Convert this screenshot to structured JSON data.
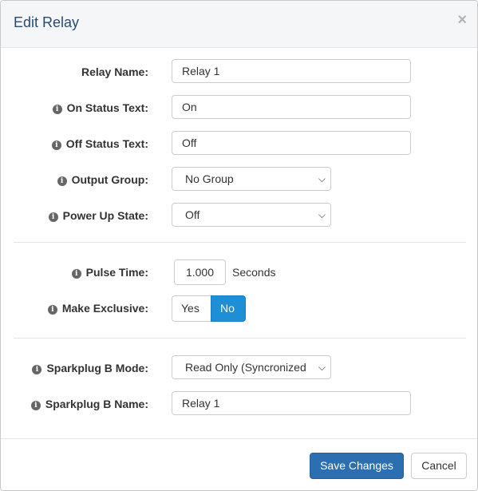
{
  "header": {
    "title": "Edit Relay",
    "close_glyph": "×"
  },
  "icon_glyph": "i",
  "form": {
    "relay_name": {
      "label": "Relay Name:",
      "value": "Relay 1"
    },
    "on_status": {
      "label": "On Status Text:",
      "value": "On"
    },
    "off_status": {
      "label": "Off Status Text:",
      "value": "Off"
    },
    "output_group": {
      "label": "Output Group:",
      "value": "No Group"
    },
    "power_up_state": {
      "label": "Power Up State:",
      "value": "Off"
    },
    "pulse_time": {
      "label": "Pulse Time:",
      "value": "1.000",
      "unit": "Seconds"
    },
    "make_exclusive": {
      "label": "Make Exclusive:",
      "yes": "Yes",
      "no": "No",
      "selected": "No"
    },
    "sparkplug_mode": {
      "label": "Sparkplug B Mode:",
      "value": "Read Only (Syncronized"
    },
    "sparkplug_name": {
      "label": "Sparkplug B Name:",
      "value": "Relay 1"
    }
  },
  "footer": {
    "save_label": "Save Changes",
    "cancel_label": "Cancel"
  },
  "colors": {
    "primary": "#2b6fb0",
    "toggle_active": "#1e8fd6",
    "title": "#2a4a73"
  }
}
